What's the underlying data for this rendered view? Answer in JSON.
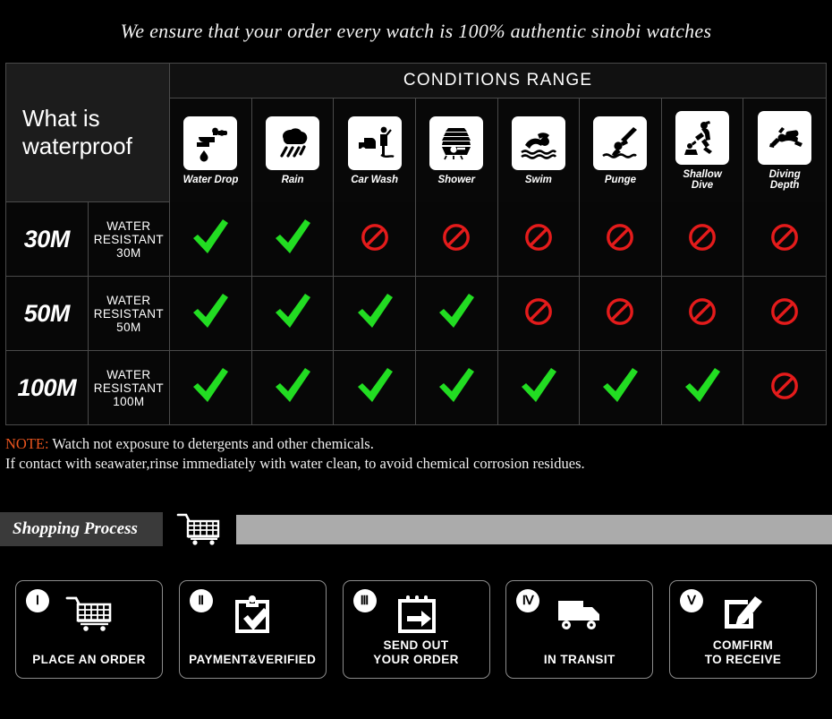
{
  "headline": "We ensure that your order every watch is 100% authentic sinobi watches",
  "table": {
    "title": "What is waterproof",
    "conditions_header": "CONDITIONS RANGE",
    "columns": [
      {
        "label": "Water Drop",
        "icon": "faucet-drip-icon"
      },
      {
        "label": "Rain",
        "icon": "rain-cloud-icon"
      },
      {
        "label": "Car Wash",
        "icon": "car-wash-icon"
      },
      {
        "label": "Shower",
        "icon": "shower-bath-icon"
      },
      {
        "label": "Swim",
        "icon": "swimmer-icon"
      },
      {
        "label": "Punge",
        "icon": "plunge-dive-icon"
      },
      {
        "label": "Shallow\nDive",
        "icon": "shallow-dive-icon"
      },
      {
        "label": "Diving\nDepth",
        "icon": "scuba-diver-icon"
      }
    ],
    "rows": [
      {
        "depth": "30M",
        "resistance": "WATER RESISTANT  30M",
        "marks": [
          "check",
          "check",
          "ban",
          "ban",
          "ban",
          "ban",
          "ban",
          "ban"
        ]
      },
      {
        "depth": "50M",
        "resistance": "WATER RESISTANT 50M",
        "marks": [
          "check",
          "check",
          "check",
          "check",
          "ban",
          "ban",
          "ban",
          "ban"
        ]
      },
      {
        "depth": "100M",
        "resistance": "WATER RESISTANT  100M",
        "marks": [
          "check",
          "check",
          "check",
          "check",
          "check",
          "check",
          "check",
          "ban"
        ]
      }
    ]
  },
  "note": {
    "keyword": "NOTE:",
    "line1": " Watch not exposure to detergents and other chemicals.",
    "line2": "If contact with seawater,rinse immediately with water clean, to avoid chemical corrosion residues."
  },
  "shopping_process": {
    "title": "Shopping Process",
    "cart_icon": "shopping-cart-icon"
  },
  "steps": [
    {
      "numeral": "Ⅰ",
      "label": "PLACE AN ORDER",
      "icon": "shopping-cart-icon"
    },
    {
      "numeral": "Ⅱ",
      "label": "PAYMENT&VERIFIED",
      "icon": "clipboard-check-icon"
    },
    {
      "numeral": "Ⅲ",
      "label": "SEND OUT\nYOUR ORDER",
      "icon": "calendar-arrow-icon"
    },
    {
      "numeral": "Ⅳ",
      "label": "IN TRANSIT",
      "icon": "delivery-truck-icon"
    },
    {
      "numeral": "Ⅴ",
      "label": "COMFIRM\nTO RECEIVE",
      "icon": "edit-pencil-icon"
    }
  ],
  "colors": {
    "check": "#22dd22",
    "ban": "#e41b1b",
    "note_keyword": "#e8541e",
    "panel": "#1c1c1c",
    "bar": "#ababab"
  }
}
